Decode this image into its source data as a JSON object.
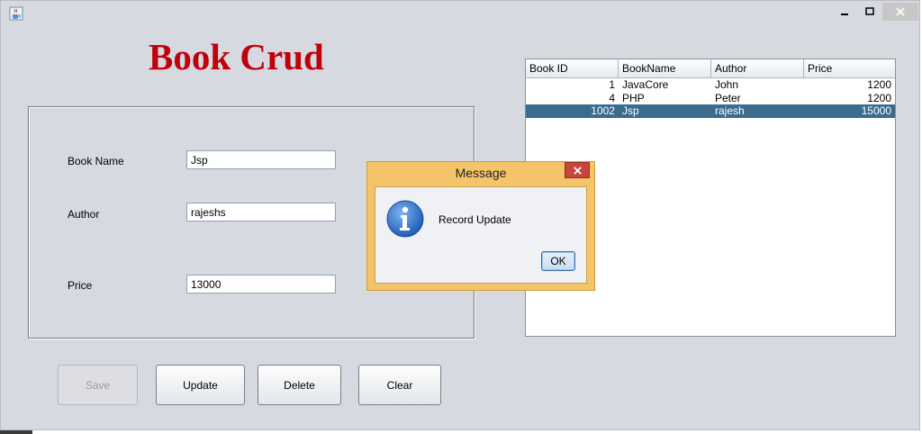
{
  "window": {
    "icon": "java-cup-icon",
    "controls": {
      "minimize": "minimize-icon",
      "maximize": "maximize-icon",
      "close": "close-icon"
    }
  },
  "heading": "Book Crud",
  "form": {
    "book_name_label": "Book Name",
    "book_name_value": "Jsp",
    "author_label": "Author",
    "author_value": "rajeshs",
    "price_label": "Price",
    "price_value": "13000"
  },
  "buttons": {
    "save": "Save",
    "update": "Update",
    "delete": "Delete",
    "clear": "Clear"
  },
  "table": {
    "columns": [
      "Book ID",
      "BookName",
      "Author",
      "Price"
    ],
    "rows": [
      {
        "id": "1",
        "name": "JavaCore",
        "author": "John",
        "price": "1200"
      },
      {
        "id": "4",
        "name": "PHP",
        "author": "Peter",
        "price": "1200"
      },
      {
        "id": "1002",
        "name": "Jsp",
        "author": "rajesh",
        "price": "15000"
      }
    ],
    "selected_row": 2
  },
  "dialog": {
    "title": "Message",
    "message": "Record Update",
    "ok_label": "OK",
    "icon": "info-icon",
    "close_icon": "close-icon"
  },
  "colors": {
    "heading": "#c0000a",
    "background": "#d6d9e0",
    "selected_row": "#3b6b8e",
    "dialog_frame": "#f4c46b",
    "dialog_close": "#c6463d"
  }
}
